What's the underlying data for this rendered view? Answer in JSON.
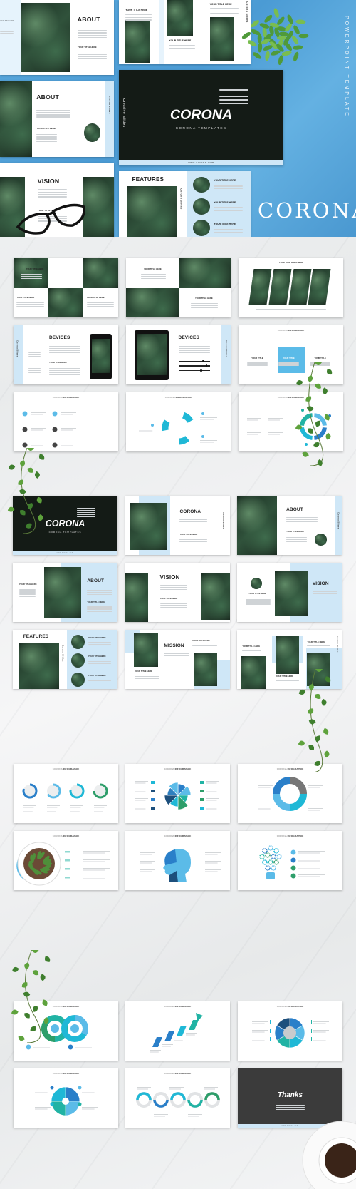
{
  "colors": {
    "hero_blue": "#4fa3dc",
    "light_blue": "#cfe7f7",
    "sky": "#5bbbe8",
    "cyan": "#1fb8d6",
    "teal": "#21b3a4",
    "green": "#2e9e6a",
    "navy": "#1d4f7c",
    "blue": "#2a7fc9",
    "dark": "#3a3a3a"
  },
  "hero": {
    "brand": "CORONA",
    "tagline": "POWERPOINT TEMPLATE",
    "slides": [
      {
        "kind": "about-right",
        "title": "ABOUT",
        "sub": "YOUR TITLE HERE",
        "left_sub": "YOUR TITLE HERE"
      },
      {
        "kind": "three-titles",
        "subs": [
          "YOUR TITLE HERE",
          "YOUR TITLE HERE",
          "YOUR TITLE HERE"
        ],
        "vertical": "Corona Slides"
      },
      {
        "kind": "cover",
        "title": "CORONA",
        "sub": "CORONA TEMPLATES",
        "url": "www.corona.com",
        "vertical": "Creative Slides"
      },
      {
        "kind": "about-band",
        "title": "ABOUT",
        "sub": "YOUR TITLE HERE",
        "vertical": "Corona Slides"
      },
      {
        "kind": "vision",
        "title": "VISION",
        "sub": "YOUR TITLE HERE"
      },
      {
        "kind": "features",
        "title": "FEATURES",
        "subs": [
          "YOUR TITLE HERE",
          "YOUR TITLE HERE",
          "YOUR TITLE HERE"
        ],
        "vertical": "Corona Slides"
      }
    ]
  },
  "sections": [
    {
      "slides": [
        {
          "kind": "grid6",
          "subs": [
            "YOUR TITLE HERE",
            "YOUR TITLE HERE",
            "YOUR TITLE HERE"
          ]
        },
        {
          "kind": "grid4",
          "subs": [
            "YOUR TITLE HERE",
            "YOUR TITLE HERE"
          ]
        },
        {
          "kind": "strips",
          "title": "YOUR TITLE GOES HERE"
        },
        {
          "kind": "phone",
          "title": "DEVICES",
          "sub": "YOUR TITLE HERE",
          "vertical": "Corona Slides"
        },
        {
          "kind": "tablet",
          "title": "DEVICES",
          "vertical": "Corona Slides"
        },
        {
          "kind": "boxes",
          "header": [
            "CORONA",
            "INFOGRAPHIC"
          ],
          "subs": [
            "YOUR TITLE",
            "YOUR TITLE",
            "YOUR TITLE"
          ]
        },
        {
          "kind": "list6",
          "header": [
            "CORONA",
            "INFOGRAPHIC"
          ]
        },
        {
          "kind": "cycle",
          "header": [
            "CORONA",
            "INFOGRAPHIC"
          ]
        },
        {
          "kind": "ring",
          "header": [
            "CORONA",
            "INFOGRAPHIC"
          ]
        }
      ]
    },
    {
      "slides": [
        {
          "kind": "cover",
          "title": "CORONA",
          "sub": "CORONA TEMPLATES",
          "url": "www.corona.com"
        },
        {
          "kind": "corona-split",
          "title": "CORONA",
          "sub": "YOUR TITLE HERE",
          "vertical": "Corona Slides"
        },
        {
          "kind": "about-photo",
          "title": "ABOUT",
          "sub": "YOUR TITLE HERE",
          "vertical": "Corona Slides"
        },
        {
          "kind": "about-blue",
          "title": "ABOUT",
          "sub": "YOUR TITLE HERE",
          "left_sub": "YOUR TITLE HERE"
        },
        {
          "kind": "vision",
          "title": "VISION",
          "sub": "YOUR TITLE HERE"
        },
        {
          "kind": "vision-blue",
          "title": "VISION",
          "sub": "YOUR TITLE HERE"
        },
        {
          "kind": "features",
          "title": "FEATURES",
          "subs": [
            "YOUR TITLE HERE",
            "YOUR TITLE HERE",
            "YOUR TITLE HERE"
          ],
          "vertical": "Corona Slides"
        },
        {
          "kind": "mission",
          "title": "MISSION",
          "subs": [
            "YOUR TITLE HERE",
            "YOUR TITLE HERE"
          ]
        },
        {
          "kind": "collage",
          "subs": [
            "YOUR TITLE HERE",
            "YOUR TITLE HERE",
            "YOUR TITLE HERE"
          ],
          "vertical": "Corona Slides"
        }
      ]
    },
    {
      "slides": [
        {
          "kind": "donuts",
          "header": [
            "CORONA",
            "INFOGRAPHIC"
          ]
        },
        {
          "kind": "polar",
          "header": [
            "CORONA",
            "INFOGRAPHIC"
          ]
        },
        {
          "kind": "cycle4",
          "header": [
            "CORONA",
            "INFOGRAPHIC"
          ]
        },
        {
          "kind": "rings",
          "header": [
            "CORONA",
            "INFOGRAPHIC"
          ]
        },
        {
          "kind": "head",
          "header": [
            "CORONA",
            "INFOGRAPHIC"
          ]
        },
        {
          "kind": "bulb",
          "header": [
            "CORONA",
            "INFOGRAPHIC"
          ]
        }
      ]
    },
    {
      "slides": [
        {
          "kind": "infinity",
          "header": [
            "CORONA",
            "INFOGRAPHIC"
          ]
        },
        {
          "kind": "arrows",
          "header": [
            "CORONA",
            "INFOGRAPHIC"
          ]
        },
        {
          "kind": "wheel",
          "header": [
            "CORONA",
            "INFOGRAPHIC"
          ]
        },
        {
          "kind": "gear",
          "header": [
            "CORONA",
            "INFOGRAPHIC"
          ]
        },
        {
          "kind": "wave",
          "header": [
            "CORONA",
            "INFOGRAPHIC"
          ]
        },
        {
          "kind": "thanks",
          "title": "Thanks",
          "url": "www.corona.com"
        }
      ]
    }
  ]
}
